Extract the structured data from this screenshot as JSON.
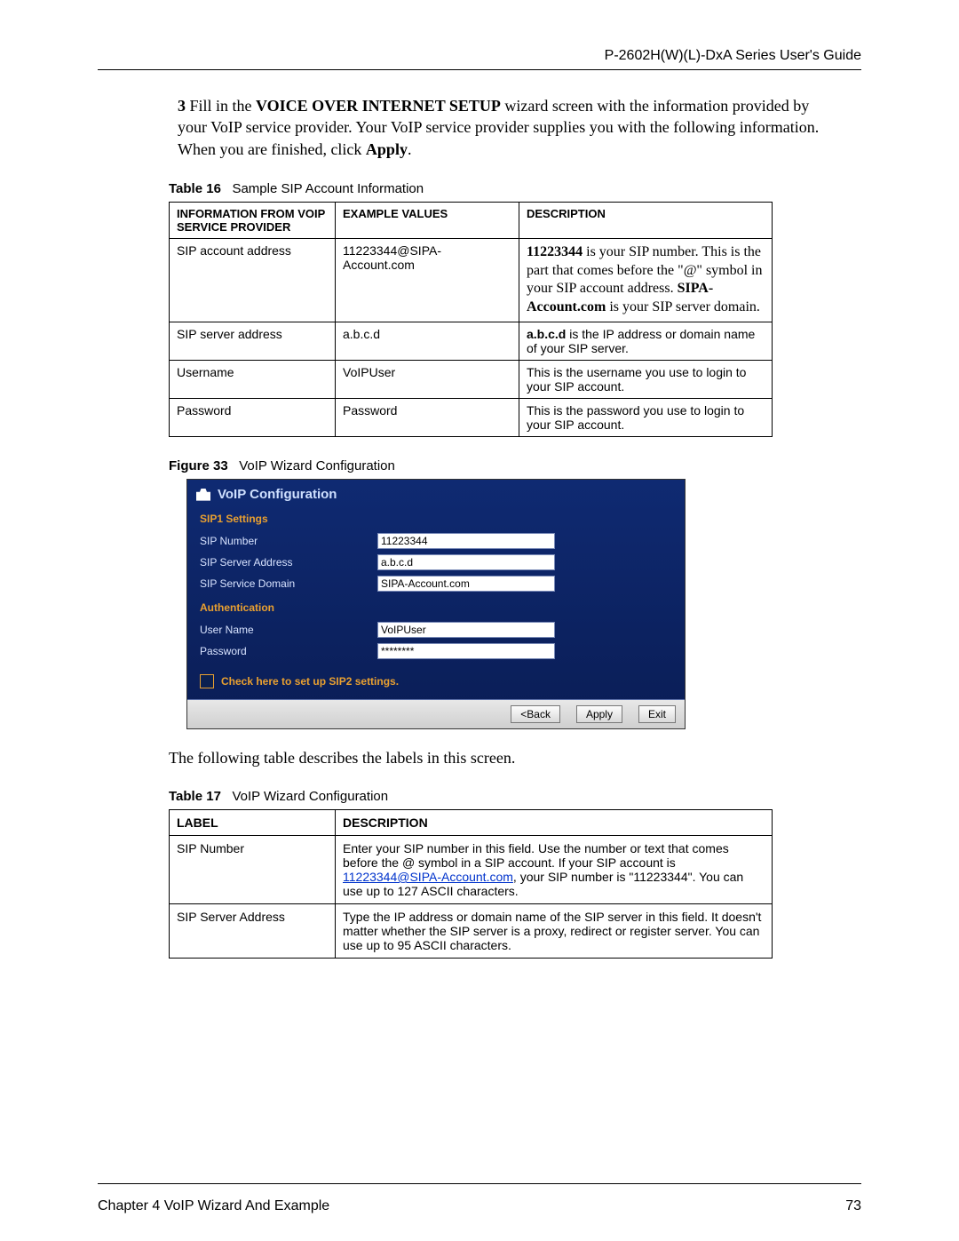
{
  "header": {
    "guide_title": "P-2602H(W)(L)-DxA Series User's Guide"
  },
  "step": {
    "num": "3",
    "prefix": "Fill in the ",
    "bold_name": "VOICE OVER INTERNET SETUP",
    "mid": " wizard screen with the information provided by your VoIP service provider. Your VoIP service provider supplies you with the following information. When you are finished, click ",
    "apply_word": "Apply",
    "suffix": "."
  },
  "table16": {
    "caption_label": "Table 16",
    "caption_text": "Sample SIP Account Information",
    "head": {
      "c1": "INFORMATION FROM VOIP SERVICE PROVIDER",
      "c2": "EXAMPLE VALUES",
      "c3": "DESCRIPTION"
    },
    "rows": [
      {
        "c1": "SIP account address",
        "c2": "11223344@SIPA-Account.com",
        "c3_html": true,
        "c3_num": "11223344",
        "c3_a": " is your SIP number. This is the part that comes before the \"",
        "c3_at": "@",
        "c3_b": "\" symbol in your SIP account address. ",
        "c3_dom": "SIPA-Account.com",
        "c3_c": " is your SIP server domain."
      },
      {
        "c1": "SIP server address",
        "c2": "a.b.c.d",
        "c3_bold": "a.b.c.d",
        "c3_rest": " is the IP address or domain name of your SIP server."
      },
      {
        "c1": "Username",
        "c2": "VoIPUser",
        "c3_plain": "This is the username you use to login to your SIP account."
      },
      {
        "c1": "Password",
        "c2": "Password",
        "c3_plain": "This is the password you use to login to your SIP account."
      }
    ]
  },
  "figure33": {
    "caption_label": "Figure 33",
    "caption_text": "VoIP Wizard Configuration",
    "panel_title": "VoIP Configuration",
    "section1": "SIP1  Settings",
    "fields1": {
      "sip_number_label": "SIP Number",
      "sip_number_value": "11223344",
      "sip_server_label": "SIP Server Address",
      "sip_server_value": "a.b.c.d",
      "sip_domain_label": "SIP Service Domain",
      "sip_domain_value": "SIPA-Account.com"
    },
    "section2": "Authentication",
    "fields2": {
      "user_label": "User Name",
      "user_value": "VoIPUser",
      "pass_label": "Password",
      "pass_value": "********"
    },
    "check_label": "Check here to set up SIP2 settings.",
    "btn_back": "<Back",
    "btn_apply": "Apply",
    "btn_exit": "Exit"
  },
  "intro17": "The following table describes the labels in this screen.",
  "table17": {
    "caption_label": "Table 17",
    "caption_text": "VoIP Wizard Configuration",
    "head": {
      "c1": "LABEL",
      "c2": "DESCRIPTION"
    },
    "rows": [
      {
        "c1": "SIP Number",
        "c2_a": "Enter your SIP number in this field. Use the number or text that comes before the @ symbol in a SIP account. If your SIP account is ",
        "c2_link": "11223344@SIPA-Account.com",
        "c2_b": ", your SIP number is \"11223344\".  You can use up to 127 ASCII characters."
      },
      {
        "c1": "SIP Server Address",
        "c2_plain": "Type the IP address or domain name of the SIP server in this field. It doesn't matter whether the SIP server is a proxy, redirect or register server. You can use up to 95 ASCII characters."
      }
    ]
  },
  "footer": {
    "chapter": "Chapter 4 VoIP Wizard And Example",
    "page": "73"
  }
}
